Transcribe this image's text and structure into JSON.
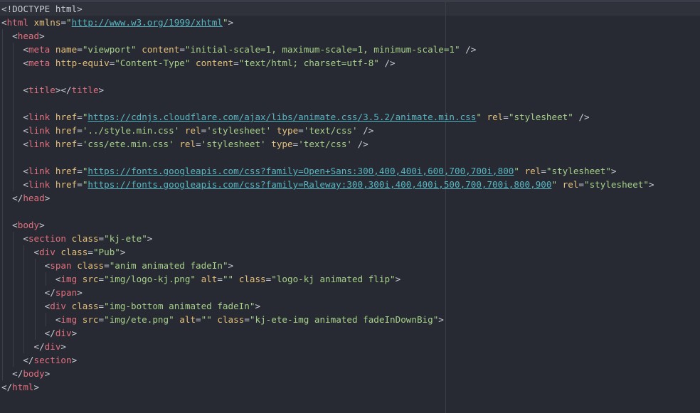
{
  "editor": {
    "lines": [
      {
        "indent": "",
        "tokens": [
          {
            "k": "p",
            "v": "<!DOCTYPE html>"
          }
        ]
      },
      {
        "indent": "",
        "tokens": [
          {
            "k": "p",
            "v": "<"
          },
          {
            "k": "t",
            "v": "html"
          },
          {
            "k": "p",
            "v": " "
          },
          {
            "k": "a",
            "v": "xmlns"
          },
          {
            "k": "p",
            "v": "="
          },
          {
            "k": "s",
            "v": "\""
          },
          {
            "k": "u",
            "v": "http://www.w3.org/1999/xhtml"
          },
          {
            "k": "s",
            "v": "\""
          },
          {
            "k": "p",
            "v": ">"
          }
        ]
      },
      {
        "indent": "  ",
        "tokens": [
          {
            "k": "p",
            "v": "<"
          },
          {
            "k": "t",
            "v": "head"
          },
          {
            "k": "p",
            "v": ">"
          }
        ]
      },
      {
        "indent": "    ",
        "tokens": [
          {
            "k": "p",
            "v": "<"
          },
          {
            "k": "t",
            "v": "meta"
          },
          {
            "k": "p",
            "v": " "
          },
          {
            "k": "a",
            "v": "name"
          },
          {
            "k": "p",
            "v": "="
          },
          {
            "k": "s",
            "v": "\"viewport\""
          },
          {
            "k": "p",
            "v": " "
          },
          {
            "k": "a",
            "v": "content"
          },
          {
            "k": "p",
            "v": "="
          },
          {
            "k": "s",
            "v": "\"initial-scale=1, maximum-scale=1, minimum-scale=1\""
          },
          {
            "k": "p",
            "v": " />"
          }
        ]
      },
      {
        "indent": "    ",
        "tokens": [
          {
            "k": "p",
            "v": "<"
          },
          {
            "k": "t",
            "v": "meta"
          },
          {
            "k": "p",
            "v": " "
          },
          {
            "k": "a",
            "v": "http-equiv"
          },
          {
            "k": "p",
            "v": "="
          },
          {
            "k": "s",
            "v": "\"Content-Type\""
          },
          {
            "k": "p",
            "v": " "
          },
          {
            "k": "a",
            "v": "content"
          },
          {
            "k": "p",
            "v": "="
          },
          {
            "k": "s",
            "v": "\"text/html; charset=utf-8\""
          },
          {
            "k": "p",
            "v": " />"
          }
        ]
      },
      {
        "indent": "",
        "tokens": []
      },
      {
        "indent": "    ",
        "tokens": [
          {
            "k": "p",
            "v": "<"
          },
          {
            "k": "t",
            "v": "title"
          },
          {
            "k": "p",
            "v": "></"
          },
          {
            "k": "t",
            "v": "title"
          },
          {
            "k": "p",
            "v": ">"
          }
        ]
      },
      {
        "indent": "",
        "tokens": []
      },
      {
        "indent": "    ",
        "tokens": [
          {
            "k": "p",
            "v": "<"
          },
          {
            "k": "t",
            "v": "link"
          },
          {
            "k": "p",
            "v": " "
          },
          {
            "k": "a",
            "v": "href"
          },
          {
            "k": "p",
            "v": "="
          },
          {
            "k": "s",
            "v": "\""
          },
          {
            "k": "u",
            "v": "https://cdnjs.cloudflare.com/ajax/libs/animate.css/3.5.2/animate.min.css"
          },
          {
            "k": "s",
            "v": "\""
          },
          {
            "k": "p",
            "v": " "
          },
          {
            "k": "a",
            "v": "rel"
          },
          {
            "k": "p",
            "v": "="
          },
          {
            "k": "s",
            "v": "\"stylesheet\""
          },
          {
            "k": "p",
            "v": " />"
          }
        ]
      },
      {
        "indent": "    ",
        "tokens": [
          {
            "k": "p",
            "v": "<"
          },
          {
            "k": "t",
            "v": "link"
          },
          {
            "k": "p",
            "v": " "
          },
          {
            "k": "a",
            "v": "href"
          },
          {
            "k": "p",
            "v": "="
          },
          {
            "k": "s",
            "v": "'../style.min.css'"
          },
          {
            "k": "p",
            "v": " "
          },
          {
            "k": "a",
            "v": "rel"
          },
          {
            "k": "p",
            "v": "="
          },
          {
            "k": "s",
            "v": "'stylesheet'"
          },
          {
            "k": "p",
            "v": " "
          },
          {
            "k": "a",
            "v": "type"
          },
          {
            "k": "p",
            "v": "="
          },
          {
            "k": "s",
            "v": "'text/css'"
          },
          {
            "k": "p",
            "v": " />"
          }
        ]
      },
      {
        "indent": "    ",
        "tokens": [
          {
            "k": "p",
            "v": "<"
          },
          {
            "k": "t",
            "v": "link"
          },
          {
            "k": "p",
            "v": " "
          },
          {
            "k": "a",
            "v": "href"
          },
          {
            "k": "p",
            "v": "="
          },
          {
            "k": "s",
            "v": "'css/ete.min.css'"
          },
          {
            "k": "p",
            "v": " "
          },
          {
            "k": "a",
            "v": "rel"
          },
          {
            "k": "p",
            "v": "="
          },
          {
            "k": "s",
            "v": "'stylesheet'"
          },
          {
            "k": "p",
            "v": " "
          },
          {
            "k": "a",
            "v": "type"
          },
          {
            "k": "p",
            "v": "="
          },
          {
            "k": "s",
            "v": "'text/css'"
          },
          {
            "k": "p",
            "v": " />"
          }
        ]
      },
      {
        "indent": "",
        "tokens": []
      },
      {
        "indent": "    ",
        "tokens": [
          {
            "k": "p",
            "v": "<"
          },
          {
            "k": "t",
            "v": "link"
          },
          {
            "k": "p",
            "v": " "
          },
          {
            "k": "a",
            "v": "href"
          },
          {
            "k": "p",
            "v": "="
          },
          {
            "k": "s",
            "v": "\""
          },
          {
            "k": "u",
            "v": "https://fonts.googleapis.com/css?family=Open+Sans:300,400,400i,600,700,700i,800"
          },
          {
            "k": "s",
            "v": "\""
          },
          {
            "k": "p",
            "v": " "
          },
          {
            "k": "a",
            "v": "rel"
          },
          {
            "k": "p",
            "v": "="
          },
          {
            "k": "s",
            "v": "\"stylesheet\""
          },
          {
            "k": "p",
            "v": ">"
          }
        ]
      },
      {
        "indent": "    ",
        "tokens": [
          {
            "k": "p",
            "v": "<"
          },
          {
            "k": "t",
            "v": "link"
          },
          {
            "k": "p",
            "v": " "
          },
          {
            "k": "a",
            "v": "href"
          },
          {
            "k": "p",
            "v": "="
          },
          {
            "k": "s",
            "v": "\""
          },
          {
            "k": "u",
            "v": "https://fonts.googleapis.com/css?family=Raleway:300,300i,400,400i,500,700,700i,800,900"
          },
          {
            "k": "s",
            "v": "\""
          },
          {
            "k": "p",
            "v": " "
          },
          {
            "k": "a",
            "v": "rel"
          },
          {
            "k": "p",
            "v": "="
          },
          {
            "k": "s",
            "v": "\"stylesheet\""
          },
          {
            "k": "p",
            "v": ">"
          }
        ]
      },
      {
        "indent": "  ",
        "tokens": [
          {
            "k": "p",
            "v": "</"
          },
          {
            "k": "t",
            "v": "head"
          },
          {
            "k": "p",
            "v": ">"
          }
        ]
      },
      {
        "indent": "",
        "tokens": []
      },
      {
        "indent": "  ",
        "tokens": [
          {
            "k": "p",
            "v": "<"
          },
          {
            "k": "t",
            "v": "body"
          },
          {
            "k": "p",
            "v": ">"
          }
        ]
      },
      {
        "indent": "    ",
        "tokens": [
          {
            "k": "p",
            "v": "<"
          },
          {
            "k": "t",
            "v": "section"
          },
          {
            "k": "p",
            "v": " "
          },
          {
            "k": "a",
            "v": "class"
          },
          {
            "k": "p",
            "v": "="
          },
          {
            "k": "s",
            "v": "\"kj-ete\""
          },
          {
            "k": "p",
            "v": ">"
          }
        ]
      },
      {
        "indent": "      ",
        "tokens": [
          {
            "k": "p",
            "v": "<"
          },
          {
            "k": "t",
            "v": "div"
          },
          {
            "k": "p",
            "v": " "
          },
          {
            "k": "a",
            "v": "class"
          },
          {
            "k": "p",
            "v": "="
          },
          {
            "k": "s",
            "v": "\"Pub\""
          },
          {
            "k": "p",
            "v": ">"
          }
        ]
      },
      {
        "indent": "        ",
        "tokens": [
          {
            "k": "p",
            "v": "<"
          },
          {
            "k": "t",
            "v": "span"
          },
          {
            "k": "p",
            "v": " "
          },
          {
            "k": "a",
            "v": "class"
          },
          {
            "k": "p",
            "v": "="
          },
          {
            "k": "s",
            "v": "\"anim animated fadeIn\""
          },
          {
            "k": "p",
            "v": ">"
          }
        ]
      },
      {
        "indent": "          ",
        "tokens": [
          {
            "k": "p",
            "v": "<"
          },
          {
            "k": "t",
            "v": "img"
          },
          {
            "k": "p",
            "v": " "
          },
          {
            "k": "a",
            "v": "src"
          },
          {
            "k": "p",
            "v": "="
          },
          {
            "k": "s",
            "v": "\"img/logo-kj.png\""
          },
          {
            "k": "p",
            "v": " "
          },
          {
            "k": "a",
            "v": "alt"
          },
          {
            "k": "p",
            "v": "="
          },
          {
            "k": "s",
            "v": "\"\""
          },
          {
            "k": "p",
            "v": " "
          },
          {
            "k": "a",
            "v": "class"
          },
          {
            "k": "p",
            "v": "="
          },
          {
            "k": "s",
            "v": "\"logo-kj animated flip\""
          },
          {
            "k": "p",
            "v": ">"
          }
        ]
      },
      {
        "indent": "        ",
        "tokens": [
          {
            "k": "p",
            "v": "</"
          },
          {
            "k": "t",
            "v": "span"
          },
          {
            "k": "p",
            "v": ">"
          }
        ]
      },
      {
        "indent": "        ",
        "tokens": [
          {
            "k": "p",
            "v": "<"
          },
          {
            "k": "t",
            "v": "div"
          },
          {
            "k": "p",
            "v": " "
          },
          {
            "k": "a",
            "v": "class"
          },
          {
            "k": "p",
            "v": "="
          },
          {
            "k": "s",
            "v": "\"img-bottom animated fadeIn\""
          },
          {
            "k": "p",
            "v": ">"
          }
        ]
      },
      {
        "indent": "          ",
        "tokens": [
          {
            "k": "p",
            "v": "<"
          },
          {
            "k": "t",
            "v": "img"
          },
          {
            "k": "p",
            "v": " "
          },
          {
            "k": "a",
            "v": "src"
          },
          {
            "k": "p",
            "v": "="
          },
          {
            "k": "s",
            "v": "\"img/ete.png\""
          },
          {
            "k": "p",
            "v": " "
          },
          {
            "k": "a",
            "v": "alt"
          },
          {
            "k": "p",
            "v": "="
          },
          {
            "k": "s",
            "v": "\"\""
          },
          {
            "k": "p",
            "v": " "
          },
          {
            "k": "a",
            "v": "class"
          },
          {
            "k": "p",
            "v": "="
          },
          {
            "k": "s",
            "v": "\"kj-ete-img animated fadeInDownBig\""
          },
          {
            "k": "p",
            "v": ">"
          }
        ]
      },
      {
        "indent": "        ",
        "tokens": [
          {
            "k": "p",
            "v": "</"
          },
          {
            "k": "t",
            "v": "div"
          },
          {
            "k": "p",
            "v": ">"
          }
        ]
      },
      {
        "indent": "      ",
        "tokens": [
          {
            "k": "p",
            "v": "</"
          },
          {
            "k": "t",
            "v": "div"
          },
          {
            "k": "p",
            "v": ">"
          }
        ]
      },
      {
        "indent": "    ",
        "tokens": [
          {
            "k": "p",
            "v": "</"
          },
          {
            "k": "t",
            "v": "section"
          },
          {
            "k": "p",
            "v": ">"
          }
        ]
      },
      {
        "indent": "  ",
        "tokens": [
          {
            "k": "p",
            "v": "</"
          },
          {
            "k": "t",
            "v": "body"
          },
          {
            "k": "p",
            "v": ">"
          }
        ]
      },
      {
        "indent": "",
        "tokens": [
          {
            "k": "p",
            "v": "</"
          },
          {
            "k": "t",
            "v": "html"
          },
          {
            "k": "p",
            "v": ">"
          }
        ]
      }
    ]
  },
  "colors": {
    "background": "#282a33",
    "tag": "#e0707e",
    "attribute": "#e5c07b",
    "string": "#a6d189",
    "url": "#56b6c2",
    "text": "#c9ccd3"
  }
}
